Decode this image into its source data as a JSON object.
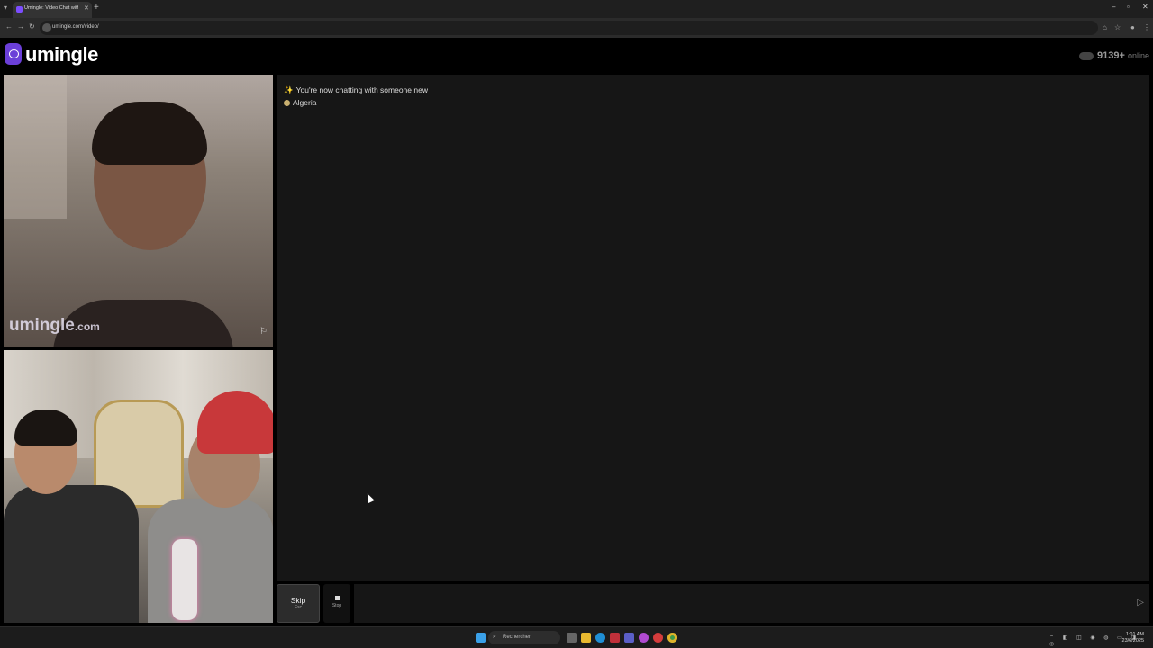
{
  "browser": {
    "tab_title": "Umingle: Video Chat with S",
    "url": "umingle.com/video/"
  },
  "header": {
    "logo_text": "umingle",
    "online_count": "9139+",
    "online_suffix": "online"
  },
  "video": {
    "watermark_main": "umingle",
    "watermark_domain": ".com"
  },
  "chat": {
    "system_message": "You're now chatting with someone new",
    "country": "Algeria"
  },
  "controls": {
    "skip_label": "Skip",
    "skip_hint": "Esc",
    "stop_label": "Stop",
    "input_placeholder": ""
  },
  "taskbar": {
    "search_placeholder": "Rechercher",
    "time": "1:01 AM",
    "date": "23/6/2025"
  },
  "colors": {
    "brand": "#6b3fd8",
    "chat_bg": "#161616",
    "page_bg": "#000000"
  }
}
